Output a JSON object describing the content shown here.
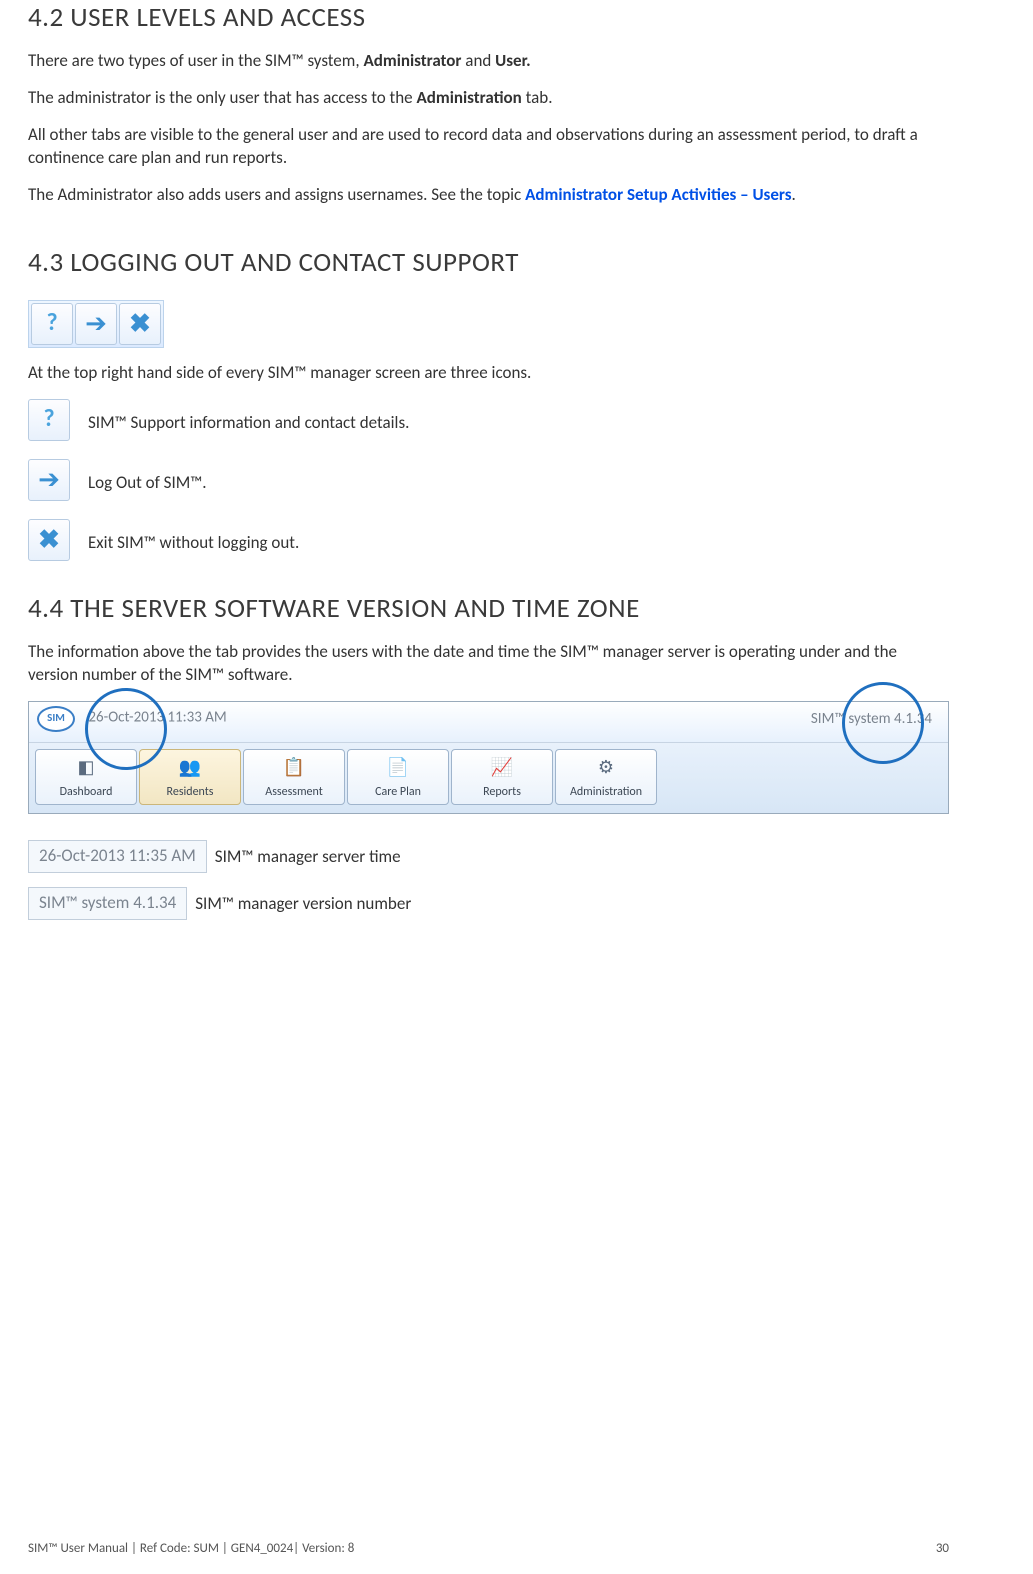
{
  "section42": {
    "heading": "4.2 USER LEVELS AND ACCESS",
    "p1a": "There are two types of user in the SIM™ system, ",
    "p1b": "Administrator",
    "p1c": " and ",
    "p1d": "User.",
    "p2a": "The administrator is the only user that has access to the ",
    "p2b": "Administration",
    "p2c": " tab.",
    "p3": "All other tabs are visible to the general user and are used to record data and observations during an assessment period, to draft a continence care plan and run reports.",
    "p4a": "The Administrator also adds users and assigns usernames. See the topic ",
    "p4link": "Administrator Setup Activities – Users",
    "p4b": "."
  },
  "section43": {
    "heading": "4.3 LOGGING OUT AND CONTACT SUPPORT",
    "intro": "At the top right hand side of every SIM™ manager screen are three icons.",
    "help": "SIM™ Support information and contact details.",
    "logout": "Log Out of SIM™.",
    "exit": "Exit SIM™ without logging out."
  },
  "section44": {
    "heading": "4.4 THE SERVER SOFTWARE VERSION AND TIME ZONE",
    "intro": "The information above the tab provides the users with the date and time the SIM™ manager server is operating under and the version number of the SIM™ software.",
    "header_time": "26-Oct-2013 11:33 AM",
    "header_version": "SIM™ system 4.1.34",
    "tabs": [
      "Dashboard",
      "Residents",
      "Assessment",
      "Care Plan",
      "Reports",
      "Administration"
    ],
    "snippet_time": "26-Oct-2013 11:35 AM",
    "snippet_time_label": "SIM™ manager server time",
    "snippet_ver": "SIM™ system 4.1.34",
    "snippet_ver_label": "SIM™ manager version number",
    "logo": "SIM"
  },
  "footer": {
    "left": "SIM™ User Manual | Ref Code: SUM | GEN4_0024| Version: 8",
    "right": "30"
  }
}
